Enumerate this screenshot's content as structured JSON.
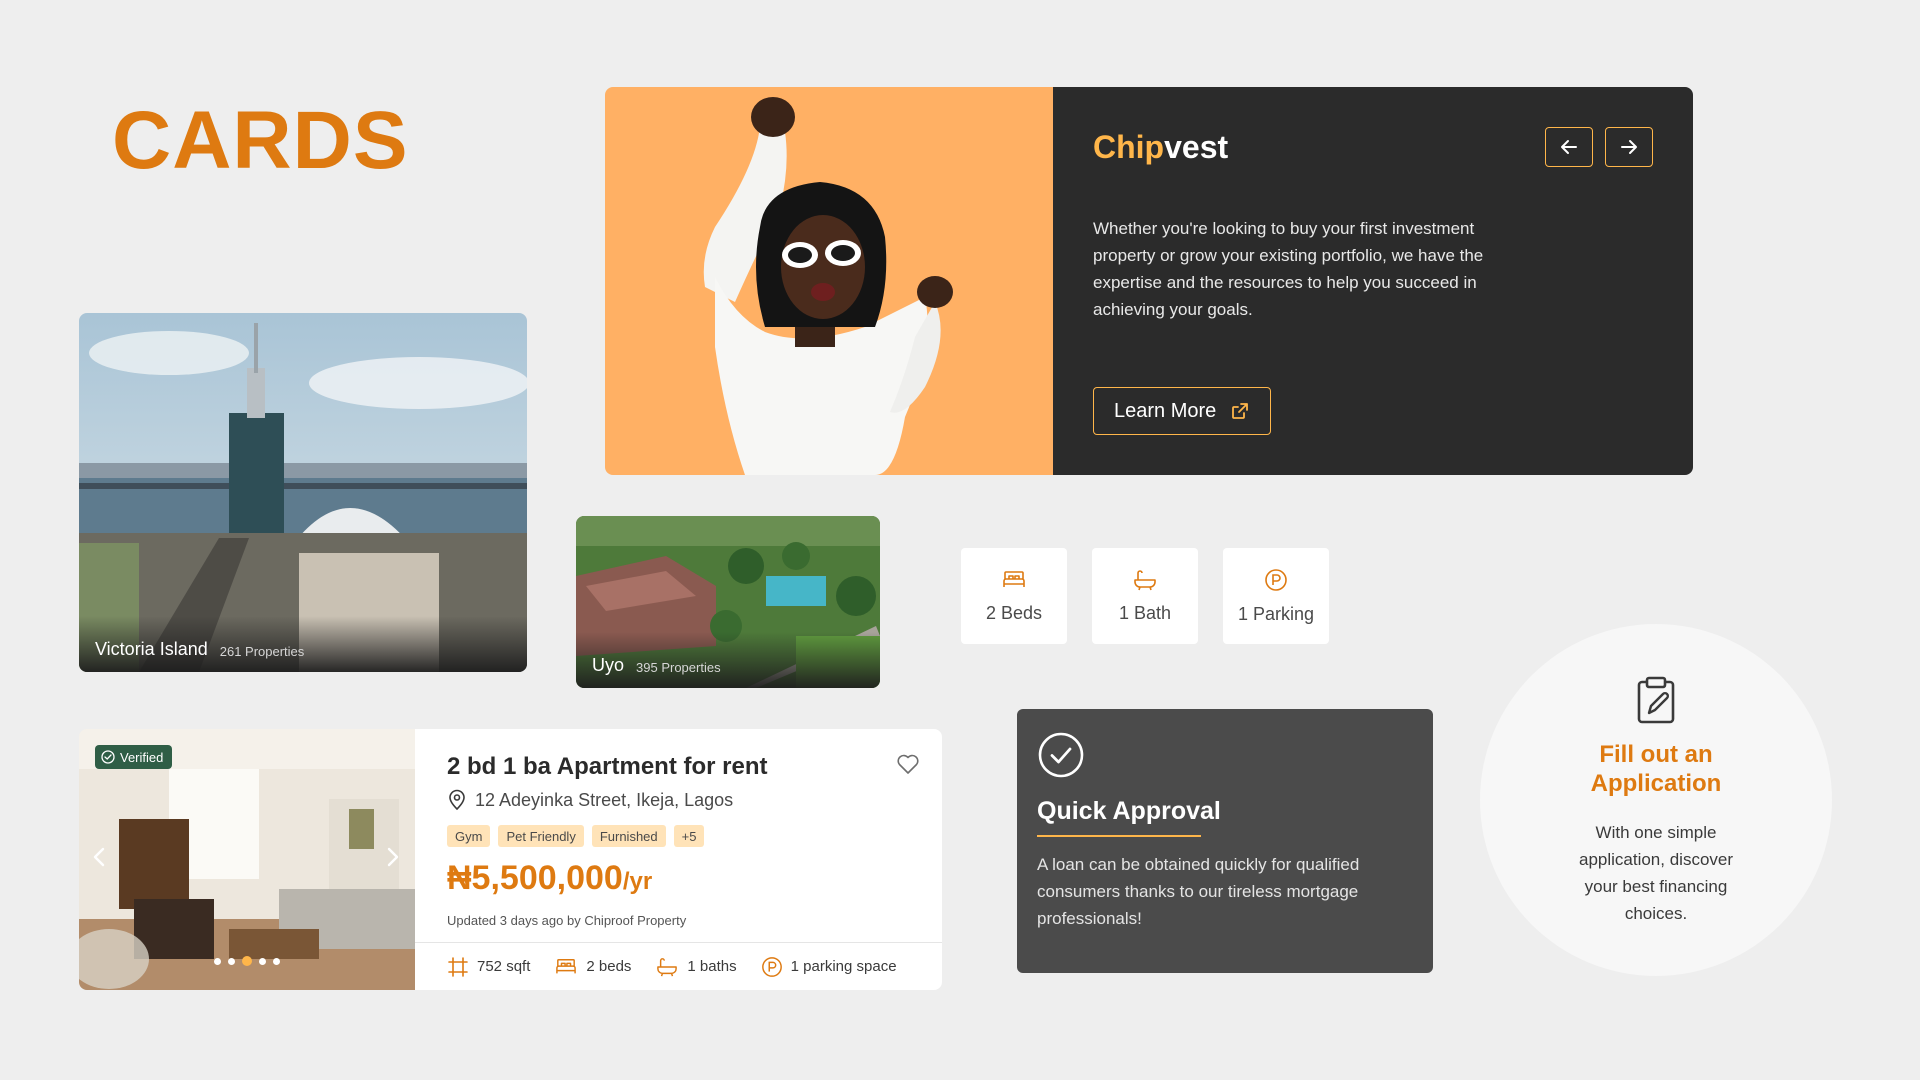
{
  "page": {
    "title": "CARDS"
  },
  "hero": {
    "brand_part1": "Chip",
    "brand_part2": "vest",
    "description": "Whether you're looking to buy your first investment property or grow your existing portfolio, we have the expertise and the resources to help you succeed in achieving your goals.",
    "cta_label": "Learn More",
    "prev_icon": "arrow-left-icon",
    "next_icon": "arrow-right-icon"
  },
  "locations": [
    {
      "name": "Victoria Island",
      "count": "261 Properties"
    },
    {
      "name": "Uyo",
      "count": "395 Properties"
    }
  ],
  "features": [
    {
      "label": "2 Beds",
      "icon": "bed-icon"
    },
    {
      "label": "1 Bath",
      "icon": "bathtub-icon"
    },
    {
      "label": "1 Parking",
      "icon": "parking-icon"
    }
  ],
  "listing": {
    "badge": "Verified",
    "title": "2 bd 1 ba Apartment for rent",
    "address": "12 Adeyinka Street, Ikeja, Lagos",
    "tags": [
      "Gym",
      "Pet Friendly",
      "Furnished",
      "+5"
    ],
    "price": "₦5,500,000",
    "price_unit": "/yr",
    "updated": "Updated 3 days ago by Chiproof Property",
    "amenities": [
      "752 sqft",
      "2 beds",
      "1 baths",
      "1 parking space"
    ],
    "carousel_active_index": 2,
    "carousel_count": 5
  },
  "approval": {
    "title": "Quick Approval",
    "text": "A loan can be obtained quickly for qualified consumers thanks to our tireless mortgage professionals!"
  },
  "application": {
    "title_line1": "Fill out an",
    "title_line2": "Application",
    "text": "With one simple application, discover your best financing choices."
  },
  "colors": {
    "accent": "#DE7A11",
    "accent_light": "#FFB64A",
    "hero_bg": "#FFB064",
    "dark": "#2B2B2B",
    "tag_bg": "#FFE3B8",
    "verified_bg": "#2F5E46"
  }
}
